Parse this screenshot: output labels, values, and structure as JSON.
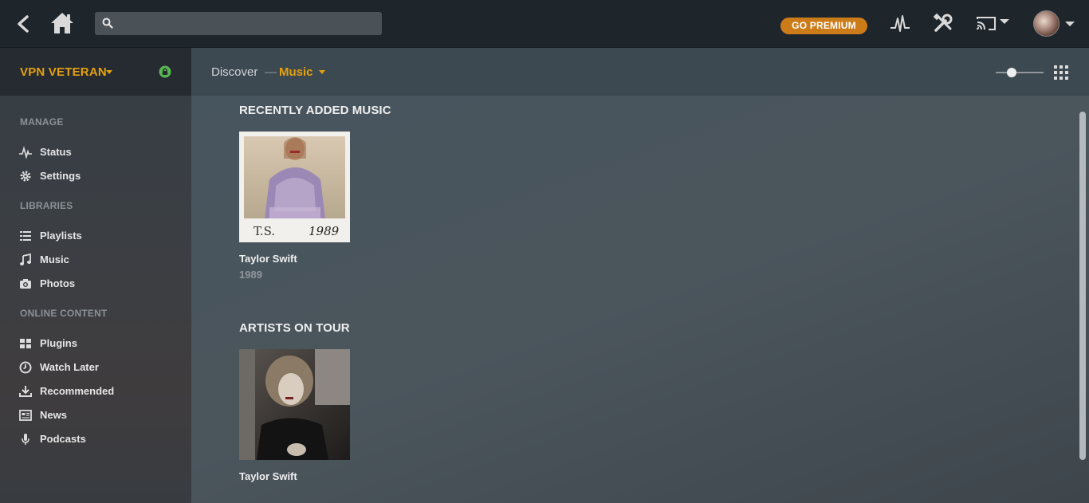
{
  "header": {
    "search_placeholder": "",
    "premium_label": "GO PREMIUM"
  },
  "sidebar": {
    "server_name": "VPN VETERAN",
    "sections": [
      {
        "title": "MANAGE",
        "items": [
          {
            "label": "Status",
            "icon": "activity-icon"
          },
          {
            "label": "Settings",
            "icon": "gear-icon"
          }
        ]
      },
      {
        "title": "LIBRARIES",
        "items": [
          {
            "label": "Playlists",
            "icon": "list-icon"
          },
          {
            "label": "Music",
            "icon": "music-note-icon"
          },
          {
            "label": "Photos",
            "icon": "camera-icon"
          }
        ]
      },
      {
        "title": "ONLINE CONTENT",
        "items": [
          {
            "label": "Plugins",
            "icon": "grid-icon"
          },
          {
            "label": "Watch Later",
            "icon": "clock-icon"
          },
          {
            "label": "Recommended",
            "icon": "download-icon"
          },
          {
            "label": "News",
            "icon": "newspaper-icon"
          },
          {
            "label": "Podcasts",
            "icon": "microphone-icon"
          }
        ]
      }
    ]
  },
  "breadcrumb": {
    "discover": "Discover",
    "separator": "—",
    "current": "Music"
  },
  "hubs": [
    {
      "title": "RECENTLY ADDED MUSIC",
      "items": [
        {
          "title": "Taylor Swift",
          "subtitle": "1989",
          "cover_text_left": "T.S.",
          "cover_text_right": "1989"
        }
      ]
    },
    {
      "title": "ARTISTS ON TOUR",
      "items": [
        {
          "title": "Taylor Swift"
        }
      ]
    }
  ],
  "colors": {
    "accent": "#e5a00d",
    "premium": "#cc7b19",
    "topbar": "#1f262b"
  }
}
